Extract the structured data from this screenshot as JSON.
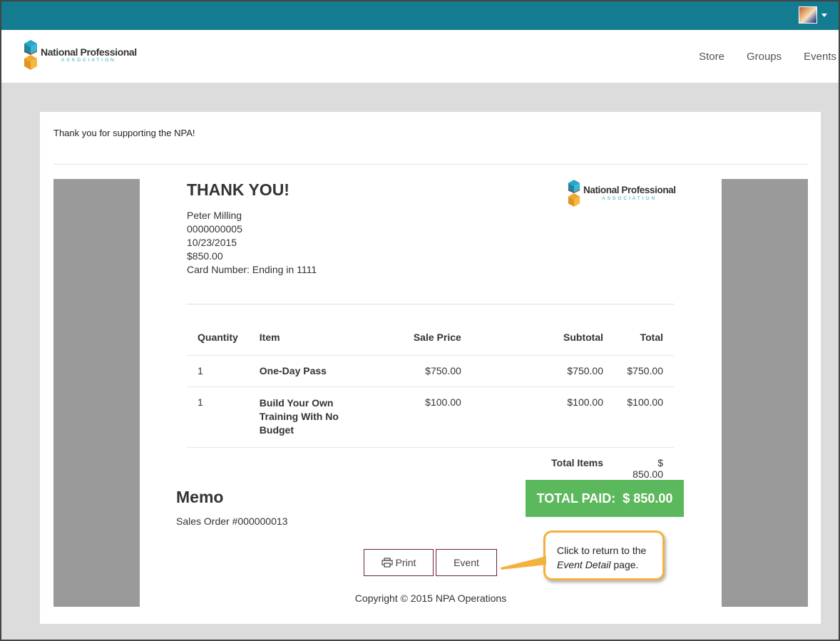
{
  "header": {
    "logo_name": "National Professional",
    "logo_sub": "ASSOCIATION",
    "nav": [
      "Store",
      "Groups",
      "Events"
    ]
  },
  "page": {
    "intro_text": "Thank you for supporting the NPA!"
  },
  "receipt": {
    "heading": "THANK YOU!",
    "logo_name": "National Professional",
    "logo_sub": "ASSOCIATION",
    "customer_name": "Peter Milling",
    "customer_id": "0000000005",
    "date": "10/23/2015",
    "amount": "$850.00",
    "card": "Card Number: Ending in 1111",
    "columns": {
      "quantity": "Quantity",
      "item": "Item",
      "sale_price": "Sale Price",
      "subtotal": "Subtotal",
      "total": "Total"
    },
    "rows": [
      {
        "quantity": "1",
        "item": "One-Day Pass",
        "sale_price": "$750.00",
        "subtotal": "$750.00",
        "total": "$750.00"
      },
      {
        "quantity": "1",
        "item": "Build Your Own Training With No Budget",
        "sale_price": "$100.00",
        "subtotal": "$100.00",
        "total": "$100.00"
      }
    ],
    "total_items_label": "Total Items",
    "total_items_value": "$ 850.00",
    "memo_title": "Memo",
    "memo_text": "Sales Order #000000013",
    "total_paid_label": "TOTAL PAID:",
    "total_paid_value": "$ 850.00",
    "print_label": "Print",
    "event_label": "Event",
    "copyright": "Copyright © 2015 NPA Operations"
  },
  "callout": {
    "line1": "Click to return to the",
    "emphasis": "Event Detail",
    "line2_rest": " page."
  },
  "colors": {
    "topbar": "#137c90",
    "total_paid_bg": "#5cb85c",
    "button_border": "#6b1f3e",
    "callout_border": "#f4b13e"
  }
}
